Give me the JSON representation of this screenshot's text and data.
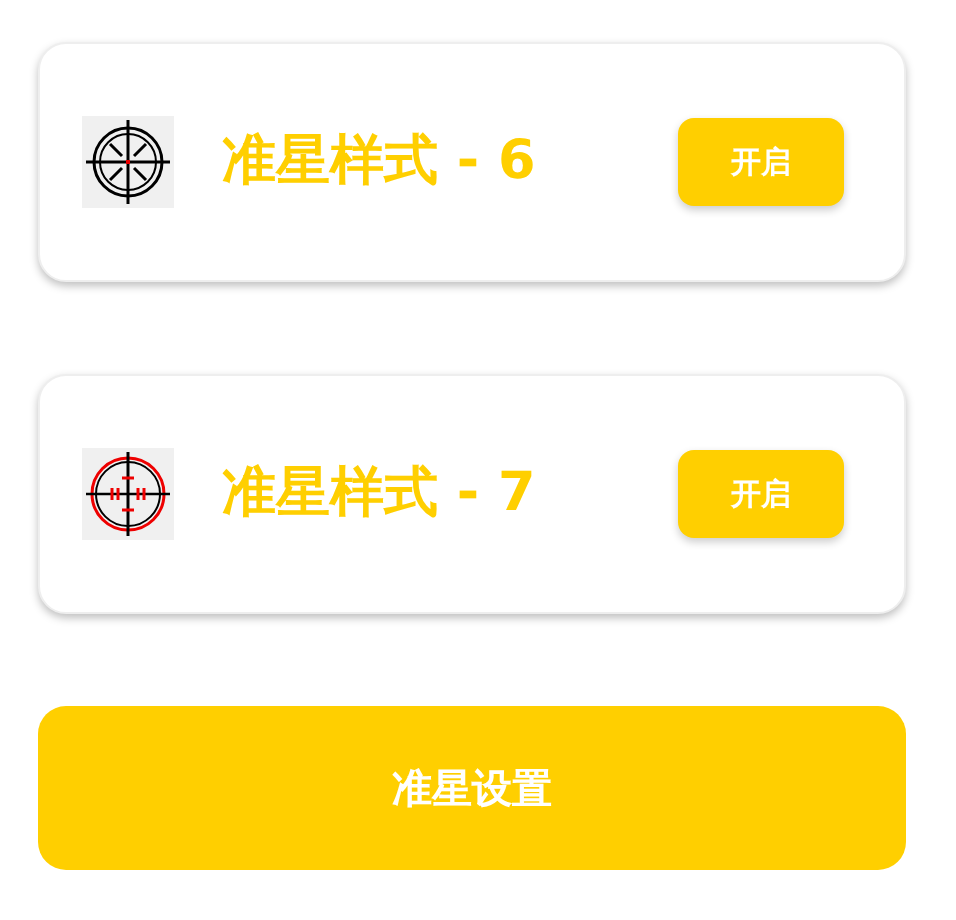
{
  "crosshairs": [
    {
      "kind": "spoked",
      "title": "准星样式 - 6",
      "button": "开启"
    },
    {
      "kind": "red-ring",
      "title": "准星样式 - 7",
      "button": "开启"
    }
  ],
  "settings_button": "准星设置"
}
